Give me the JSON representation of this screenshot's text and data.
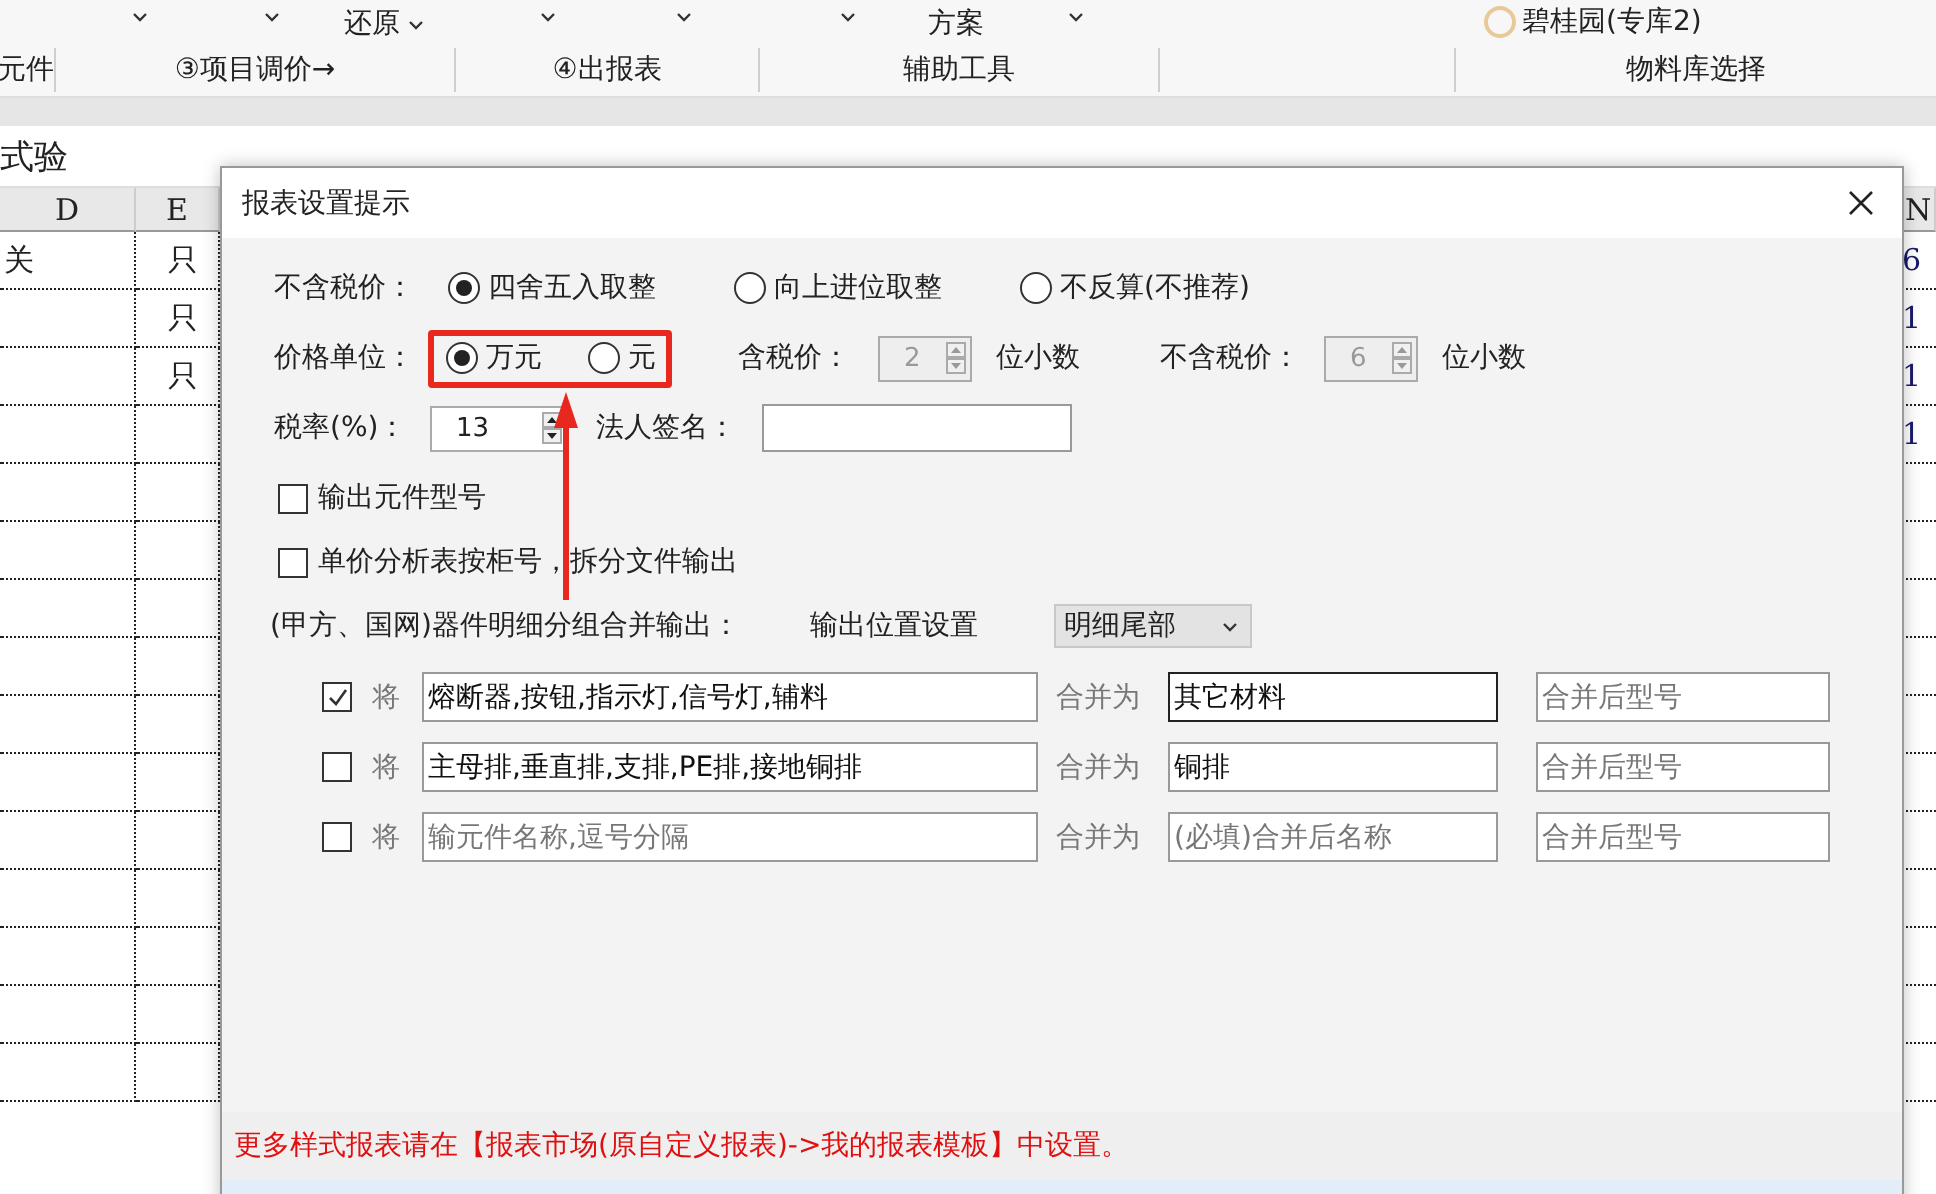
{
  "ribbon": {
    "top_items": [
      {
        "kind": "caret"
      },
      {
        "kind": "caret"
      },
      {
        "kind": "text",
        "label": "还原",
        "caret": true
      },
      {
        "kind": "caret"
      },
      {
        "kind": "caret"
      },
      {
        "kind": "caret"
      },
      {
        "kind": "text",
        "label": "方案",
        "caret": false
      },
      {
        "kind": "caret"
      },
      {
        "kind": "radio",
        "label": "碧桂园(专库2)",
        "selected": false
      }
    ],
    "groups": [
      "元件",
      "③项目调价→",
      "④出报表",
      "辅助工具",
      "物料库选择"
    ]
  },
  "sheet": {
    "name": "式验",
    "columns": [
      "D",
      "E"
    ],
    "right_column": "N",
    "rows": [
      {
        "d": "关",
        "e": "只",
        "n": "6"
      },
      {
        "d": "",
        "e": "只",
        "n": "1"
      },
      {
        "d": "",
        "e": "只",
        "n": "1"
      },
      {
        "d": "",
        "e": "",
        "n": "1"
      }
    ]
  },
  "dialog": {
    "title": "报表设置提示",
    "rounding": {
      "label": "不含税价：",
      "options": [
        {
          "label": "四舍五入取整",
          "selected": true
        },
        {
          "label": "向上进位取整",
          "selected": false
        },
        {
          "label": "不反算(不推荐)",
          "selected": false
        }
      ]
    },
    "price_unit": {
      "label": "价格单位：",
      "options": [
        {
          "label": "万元",
          "selected": true
        },
        {
          "label": "元",
          "selected": false
        }
      ]
    },
    "incl_decimals": {
      "label": "含税价：",
      "value": "2",
      "disabled": true,
      "suffix": "位小数"
    },
    "excl_decimals": {
      "label": "不含税价：",
      "value": "6",
      "disabled": true,
      "suffix": "位小数"
    },
    "tax_rate": {
      "label": "税率(%)：",
      "value": "13",
      "disabled": false
    },
    "signature": {
      "label": "法人签名："
    },
    "checkboxes": [
      {
        "label": "输出元件型号",
        "checked": false
      },
      {
        "label": "单价分析表按柜号，拆分文件输出",
        "checked": false
      }
    ],
    "merge_label": "(甲方、国网)器件明细分组合并输出：",
    "position_label": "输出位置设置",
    "position_value": "明细尾部",
    "merge_rows": [
      {
        "checked": true,
        "prefix": "将",
        "names": {
          "value": "熔断器,按钮,指示灯,信号灯,辅料"
        },
        "merge_as": "合并为",
        "merged": {
          "value": "其它材料"
        },
        "model": {
          "placeholder": "合并后型号"
        }
      },
      {
        "checked": false,
        "prefix": "将",
        "names": {
          "value": "主母排,垂直排,支排,PE排,接地铜排"
        },
        "merge_as": "合并为",
        "merged": {
          "value": "铜排"
        },
        "model": {
          "placeholder": "合并后型号"
        }
      },
      {
        "checked": false,
        "prefix": "将",
        "names": {
          "placeholder": "输元件名称,逗号分隔"
        },
        "merge_as": "合并为",
        "merged": {
          "placeholder": "(必填)合并后名称"
        },
        "model": {
          "placeholder": "合并后型号"
        }
      }
    ],
    "footer_note": "更多样式报表请在【报表市场(原自定义报表)->我的报表模板】中设置。"
  }
}
